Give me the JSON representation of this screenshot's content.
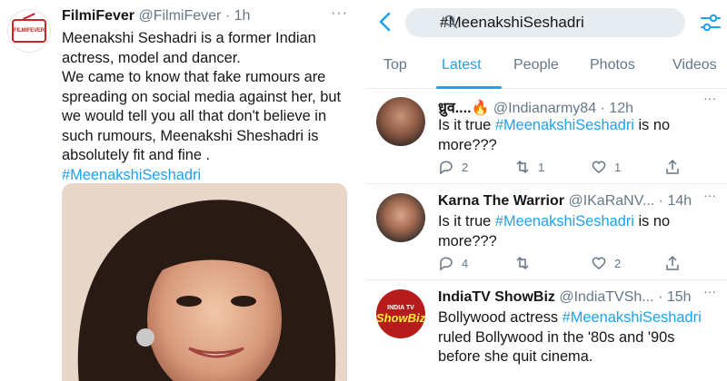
{
  "left_tweet": {
    "avatar_logo_text": "FILMIFEVER",
    "name": "FilmiFever",
    "meta": " @FilmiFever · 1h",
    "more": "···",
    "text": "Meenakshi Seshadri  is a former Indian actress, model and dancer.\nWe came to know that fake rumours are spreading on social media against her, but we would tell you all that don't believe in such rumours, Meenakshi Sheshadri is absolutely fit and fine .",
    "hashtag": "#MeenakshiSeshadri"
  },
  "right_panel": {
    "search_query": "#MeenakshiSeshadri",
    "tabs": [
      "Top",
      "Latest",
      "People",
      "Photos",
      "Videos"
    ],
    "active_tab": "Latest",
    "tweets": [
      {
        "name": "ध्रुव....🔥",
        "meta": " @Indianarmy84 · 12h",
        "text_before": "Is it true ",
        "hashtag": "#MeenakshiSeshadri",
        "text_after": " is no\nmore???",
        "replies": "2",
        "retweets": "1",
        "likes": "1"
      },
      {
        "name": "Karna The Warrior",
        "meta": " @IKaRaNV... · 14h",
        "text_before": "Is it true ",
        "hashtag": "#MeenakshiSeshadri",
        "text_after": " is no\nmore???",
        "replies": "4",
        "retweets": "",
        "likes": "2"
      },
      {
        "name": "IndiaTV ShowBiz",
        "meta": " @IndiaTVSh... · 15h",
        "avatar_small": "INDIA TV",
        "avatar_big": "ShowBiz",
        "text_before": "Bollywood actress ",
        "hashtag": "#MeenakshiSeshadri",
        "text_after": "\nruled Bollywood in the '80s and '90s before she quit cinema."
      }
    ]
  },
  "colors": {
    "accent": "#1da1f2",
    "muted": "#657786",
    "text": "#14171a",
    "search_bg": "#e6ecf0"
  }
}
